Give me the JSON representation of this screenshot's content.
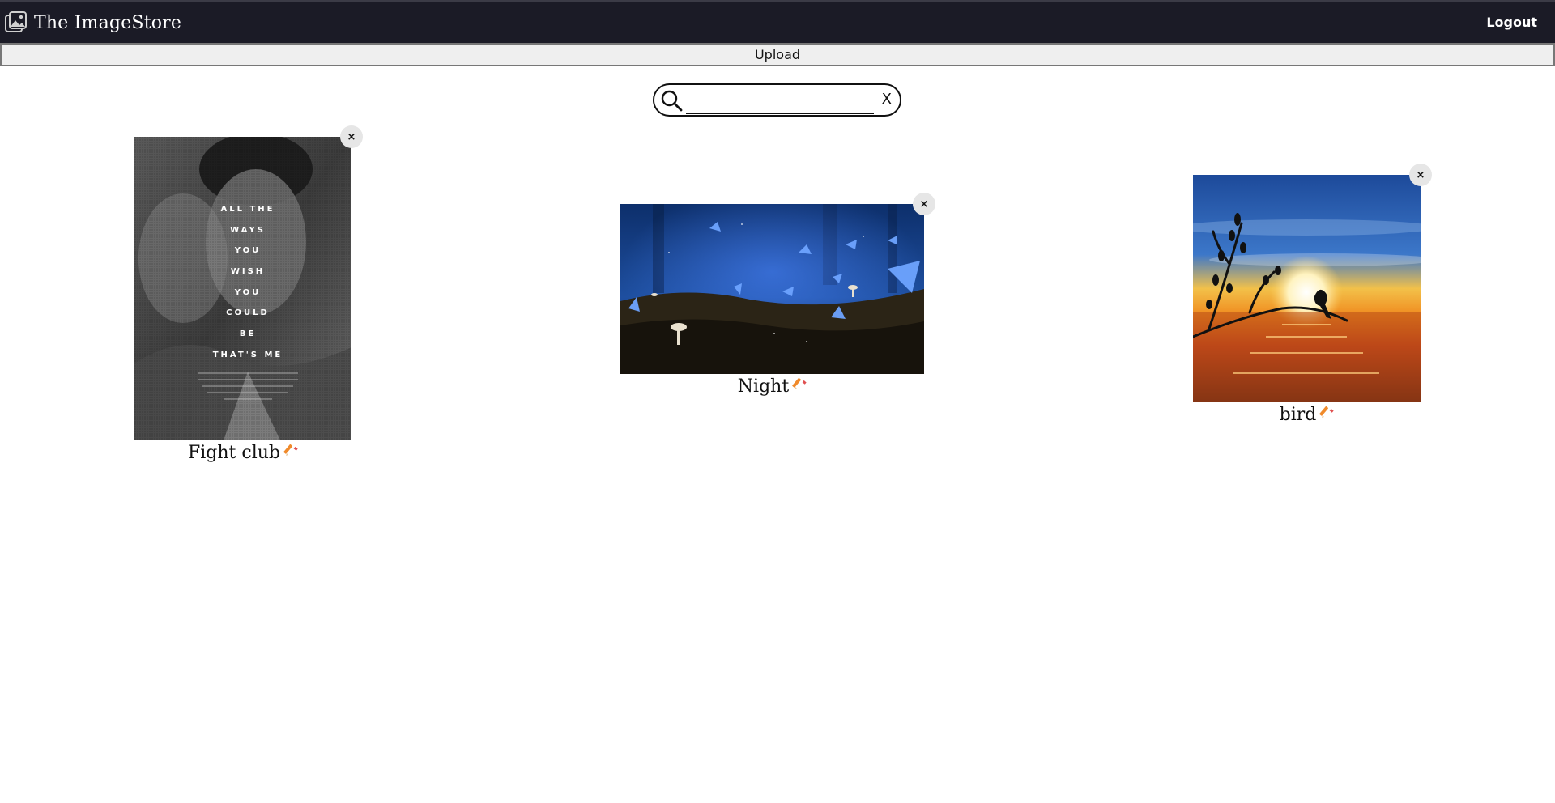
{
  "app": {
    "title": "The ImageStore",
    "logout_label": "Logout",
    "upload_label": "Upload"
  },
  "search": {
    "value": "",
    "placeholder": "",
    "clear_label": "X"
  },
  "images": [
    {
      "title": "Fight club",
      "close_label": "×",
      "poster_lines": [
        "ALL THE",
        "WAYS",
        "YOU",
        "WISH",
        "YOU",
        "COULD",
        "BE",
        "THAT'S ME"
      ]
    },
    {
      "title": "Night",
      "close_label": "×"
    },
    {
      "title": "bird",
      "close_label": "×"
    }
  ],
  "icons": {
    "brand": "image-gallery-icon",
    "search": "magnifier-icon",
    "edit": "pencil-icon"
  },
  "colors": {
    "topbar": "#1b1b26",
    "upload_bg": "#efefef",
    "edit_pencil": "#f08a2b"
  }
}
